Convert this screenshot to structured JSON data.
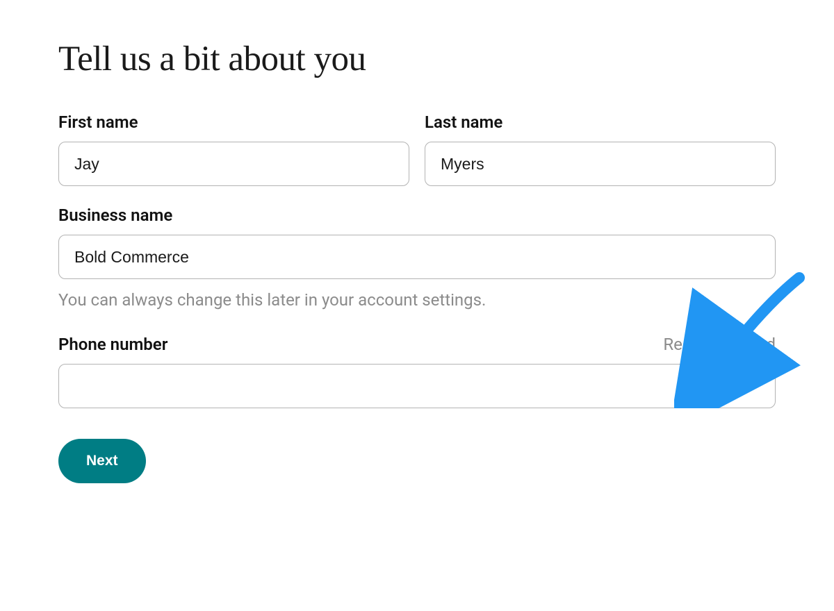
{
  "title": "Tell us a bit about you",
  "form": {
    "first_name": {
      "label": "First name",
      "value": "Jay"
    },
    "last_name": {
      "label": "Last name",
      "value": "Myers"
    },
    "business": {
      "label": "Business name",
      "value": "Bold Commerce",
      "helper": "You can always change this later in your account settings."
    },
    "phone": {
      "label": "Phone number",
      "value": "",
      "hint": "Recommended"
    }
  },
  "buttons": {
    "next": "Next"
  },
  "colors": {
    "primary": "#007d84",
    "arrow": "#2196f3"
  }
}
